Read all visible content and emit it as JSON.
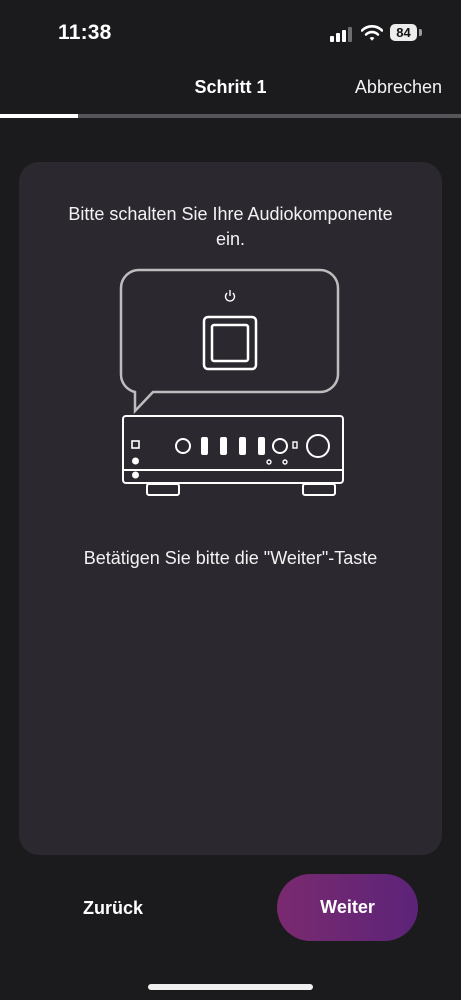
{
  "status_bar": {
    "time": "11:38",
    "battery_level": "84",
    "icons": [
      "signal-icon",
      "wifi-icon",
      "battery-icon"
    ]
  },
  "header": {
    "title": "Schritt 1",
    "cancel_label": "Abbrechen",
    "progress_fraction": 0.17
  },
  "card": {
    "instruction": "Bitte schalten Sie Ihre Audiokomponente ein.",
    "illustration": "amplifier-power-button-illustration",
    "hint": "Betätigen Sie bitte die \"Weiter\"-Taste"
  },
  "footer": {
    "back_label": "Zurück",
    "next_label": "Weiter"
  },
  "colors": {
    "background": "#1b1a1d",
    "card": "#2c2830",
    "accent_start": "#7a2a6f",
    "accent_end": "#5c2379"
  }
}
